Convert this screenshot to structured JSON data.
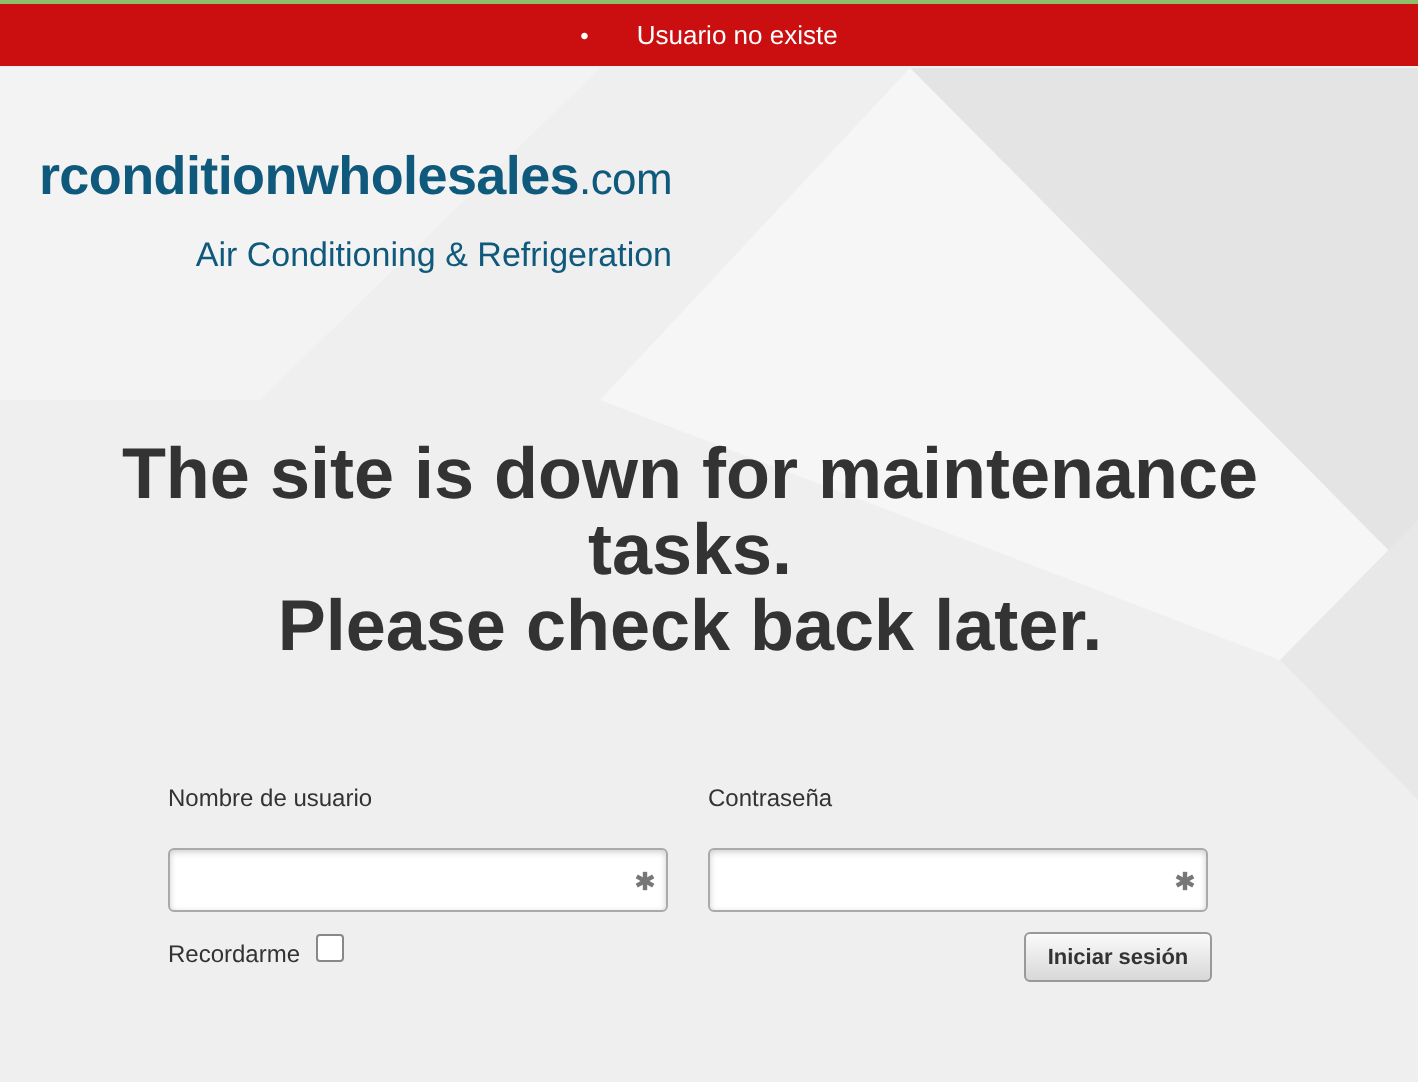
{
  "alert": {
    "bullet": "•",
    "message": "Usuario no existe"
  },
  "logo": {
    "name": "**rconditionwholesales**.com",
    "tagline": "Air Conditioning & Refrigeration"
  },
  "heading": [
    "The site is down for maintenance tasks.",
    "Please check back later."
  ],
  "form": {
    "fields": [
      {
        "label": "Nombre de usuario",
        "required": true
      },
      {
        "label": "Contraseña",
        "required": true
      }
    ],
    "remember": {
      "label": "Recordarme",
      "checked": false
    },
    "submit": "Iniciar sesión"
  }
}
